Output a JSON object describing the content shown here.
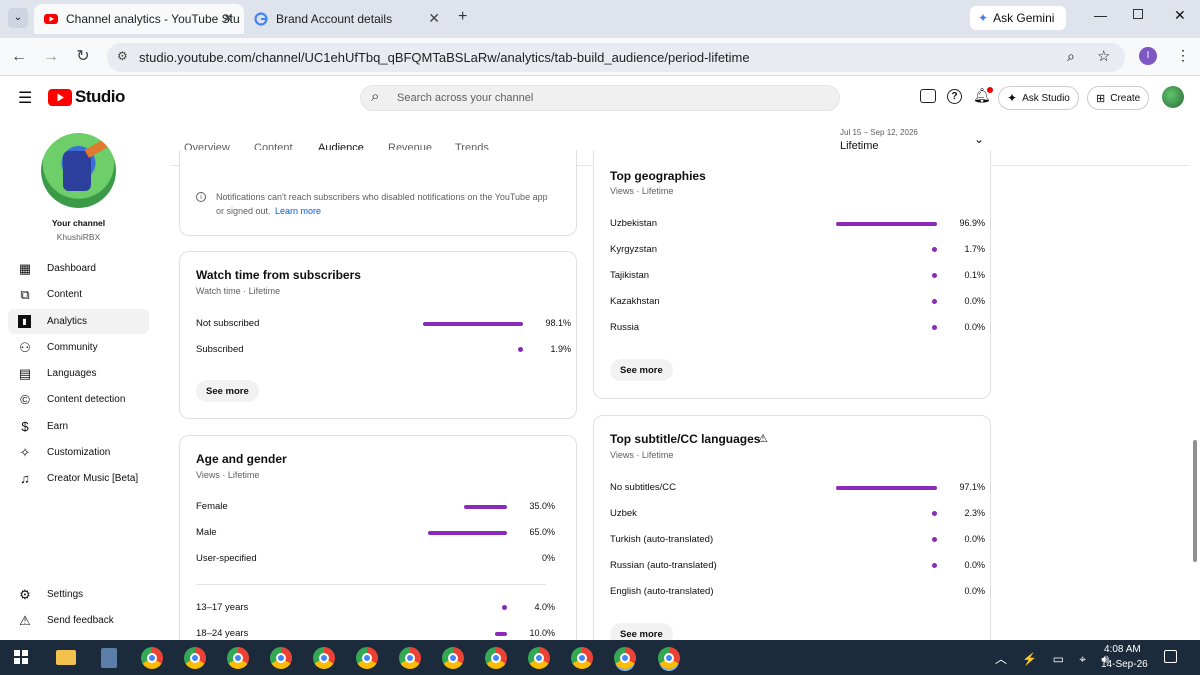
{
  "browser": {
    "tabs": [
      {
        "title": "Channel analytics - YouTube Stu"
      },
      {
        "title": "Brand Account details"
      }
    ],
    "new_tab": "+",
    "ask_gemini": "Ask Gemini",
    "url": "studio.youtube.com/channel/UC1ehUfTbq_qBFQMTaBSLaRw/analytics/tab-build_audience/period-lifetime",
    "profile_initial": "I"
  },
  "header": {
    "logo": "Studio",
    "search_placeholder": "Search across your channel",
    "ask_studio": "Ask Studio",
    "create": "Create"
  },
  "channel": {
    "label": "Your channel",
    "name": "KhushiRBX"
  },
  "sidebar": {
    "items": [
      {
        "label": "Dashboard",
        "icon": "dashboard-icon"
      },
      {
        "label": "Content",
        "icon": "content-icon"
      },
      {
        "label": "Analytics",
        "icon": "analytics-icon"
      },
      {
        "label": "Community",
        "icon": "community-icon"
      },
      {
        "label": "Languages",
        "icon": "languages-icon"
      },
      {
        "label": "Content detection",
        "icon": "copyright-icon"
      },
      {
        "label": "Earn",
        "icon": "dollar-icon"
      },
      {
        "label": "Customization",
        "icon": "wand-icon"
      },
      {
        "label": "Creator Music [Beta]",
        "icon": "music-icon"
      }
    ],
    "settings": "Settings",
    "feedback": "Send feedback"
  },
  "tabs": [
    "Overview",
    "Content",
    "Audience",
    "Revenue",
    "Trends"
  ],
  "period": {
    "range": "Jul 15 – Sep 12, 2026",
    "label": "Lifetime"
  },
  "notice": {
    "text": "Notifications can't reach subscribers who disabled notifications on the YouTube app",
    "text2": "or signed out.",
    "link": "Learn more"
  },
  "watch_time": {
    "title": "Watch time from subscribers",
    "sub": "Watch time · Lifetime",
    "rows": [
      {
        "label": "Not subscribed",
        "pct": "98.1%",
        "value": 98.1
      },
      {
        "label": "Subscribed",
        "pct": "1.9%",
        "value": 1.9
      }
    ],
    "see_more": "See more"
  },
  "age_gender": {
    "title": "Age and gender",
    "sub": "Views · Lifetime",
    "rows": [
      {
        "label": "Female",
        "pct": "35.0%",
        "value": 35.0
      },
      {
        "label": "Male",
        "pct": "65.0%",
        "value": 65.0
      },
      {
        "label": "User-specified",
        "pct": "0%",
        "value": 0
      }
    ],
    "age_rows": [
      {
        "label": "13–17 years",
        "pct": "4.0%",
        "value": 4.0
      },
      {
        "label": "18–24 years",
        "pct": "10.0%",
        "value": 10.0
      }
    ]
  },
  "geo": {
    "title": "Top geographies",
    "sub": "Views · Lifetime",
    "rows": [
      {
        "label": "Uzbekistan",
        "pct": "96.9%",
        "value": 96.9
      },
      {
        "label": "Kyrgyzstan",
        "pct": "1.7%",
        "value": 1.7
      },
      {
        "label": "Tajikistan",
        "pct": "0.1%",
        "value": 0.1
      },
      {
        "label": "Kazakhstan",
        "pct": "0.0%",
        "value": 0.0
      },
      {
        "label": "Russia",
        "pct": "0.0%",
        "value": 0.0
      }
    ],
    "see_more": "See more"
  },
  "subs_lang": {
    "title": "Top subtitle/CC languages",
    "sub": "Views · Lifetime",
    "rows": [
      {
        "label": "No subtitles/CC",
        "pct": "97.1%",
        "value": 97.1
      },
      {
        "label": "Uzbek",
        "pct": "2.3%",
        "value": 2.3
      },
      {
        "label": "Turkish (auto-translated)",
        "pct": "0.0%",
        "value": 0.0
      },
      {
        "label": "Russian (auto-translated)",
        "pct": "0.0%",
        "value": 0.0
      },
      {
        "label": "English (auto-translated)",
        "pct": "0.0%",
        "value": 0.0,
        "nodot": true
      }
    ],
    "see_more": "See more"
  },
  "taskbar": {
    "time": "4:08 AM",
    "date": "14-Sep-26"
  },
  "colors": {
    "accent": "#8a2aba",
    "youtube_red": "#ff0000"
  }
}
